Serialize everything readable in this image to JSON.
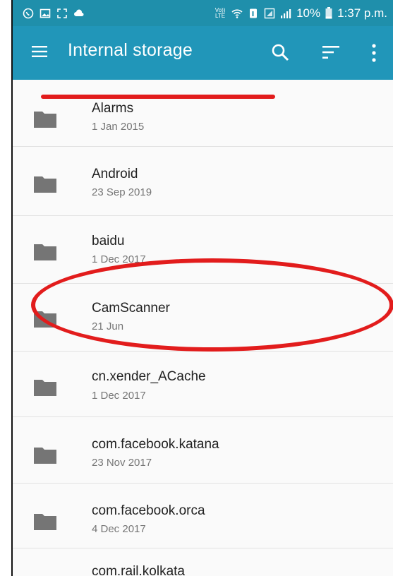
{
  "status_bar": {
    "volte": "Vo)) LTE",
    "battery_percent": "10%",
    "time": "1:37 p.m."
  },
  "app_bar": {
    "title": "Internal storage"
  },
  "files": [
    {
      "name": "Alarms",
      "date": "1 Jan 2015"
    },
    {
      "name": "Android",
      "date": "23 Sep 2019"
    },
    {
      "name": "baidu",
      "date": "1 Dec 2017"
    },
    {
      "name": "CamScanner",
      "date": "21 Jun"
    },
    {
      "name": "cn.xender_ACache",
      "date": "1 Dec 2017"
    },
    {
      "name": "com.facebook.katana",
      "date": "23 Nov 2017"
    },
    {
      "name": "com.facebook.orca",
      "date": "4 Dec 2017"
    },
    {
      "name": "com.rail.kolkata",
      "date": ""
    }
  ],
  "colors": {
    "status_bar": "#1f8fab",
    "app_bar": "#2196b9",
    "annotation": "#e21c1c",
    "folder": "#757575"
  },
  "icons": [
    "whatsapp-icon",
    "gallery-icon",
    "screenshot-icon",
    "cloud-icon",
    "wifi-icon",
    "sim-icon",
    "signal-icon",
    "battery-icon",
    "menu-icon",
    "search-icon",
    "sort-icon",
    "more-icon",
    "folder-icon"
  ]
}
